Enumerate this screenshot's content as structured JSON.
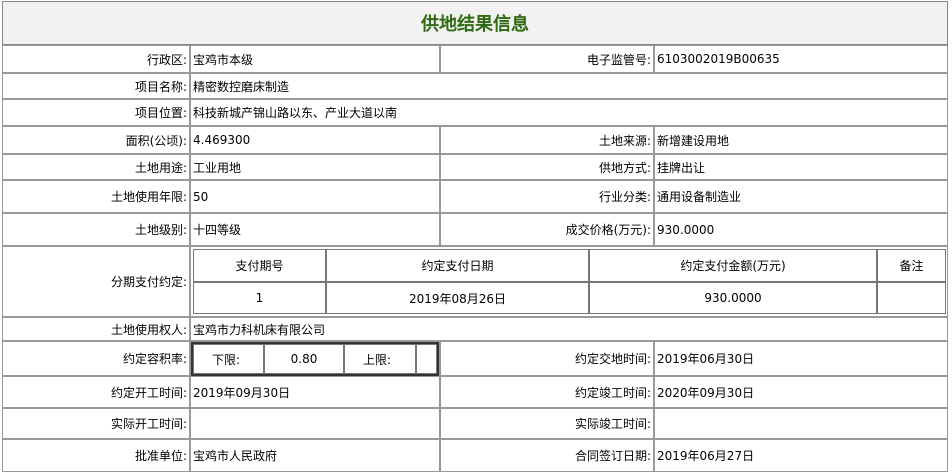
{
  "page": {
    "title": "供地结果信息"
  },
  "fields": {
    "district_label": "行政区:",
    "district_value": "宝鸡市本级",
    "supervision_no_label": "电子监管号:",
    "supervision_no_value": "6103002019B00635",
    "project_name_label": "项目名称:",
    "project_name_value": "精密数控磨床制造",
    "project_location_label": "项目位置:",
    "project_location_value": "科技新城产锦山路以东、产业大道以南",
    "area_label": "面积(公顷):",
    "area_value": "4.469300",
    "land_source_label": "土地来源:",
    "land_source_value": "新增建设用地",
    "land_use_label": "土地用途:",
    "land_use_value": "工业用地",
    "supply_method_label": "供地方式:",
    "supply_method_value": "挂牌出让",
    "use_term_label": "土地使用年限:",
    "use_term_value": "50",
    "industry_label": "行业分类:",
    "industry_value": "通用设备制造业",
    "land_grade_label": "土地级别:",
    "land_grade_value": "十四等级",
    "deal_price_label": "成交价格(万元):",
    "deal_price_value": "930.0000",
    "installment_label": "分期支付约定:",
    "user_label": "土地使用权人:",
    "user_value": "宝鸡市力科机床有限公司",
    "plot_ratio_label": "约定容积率:",
    "lower_label": "下限:",
    "lower_value": "0.80",
    "upper_label": "上限:",
    "upper_value": "",
    "delivery_time_label": "约定交地时间:",
    "delivery_time_value": "2019年06月30日",
    "start_time_label": "约定开工时间:",
    "start_time_value": "2019年09月30日",
    "finish_time_label": "约定竣工时间:",
    "finish_time_value": "2020年09月30日",
    "actual_start_label": "实际开工时间:",
    "actual_start_value": "",
    "actual_finish_label": "实际竣工时间:",
    "actual_finish_value": "",
    "approver_label": "批准单位:",
    "approver_value": "宝鸡市人民政府",
    "contract_date_label": "合同签订日期:",
    "contract_date_value": "2019年06月27日"
  },
  "payment_table": {
    "headers": [
      "支付期号",
      "约定支付日期",
      "约定支付金额(万元)",
      "备注"
    ],
    "rows": [
      [
        "1",
        "2019年08月26日",
        "930.0000",
        ""
      ]
    ]
  }
}
